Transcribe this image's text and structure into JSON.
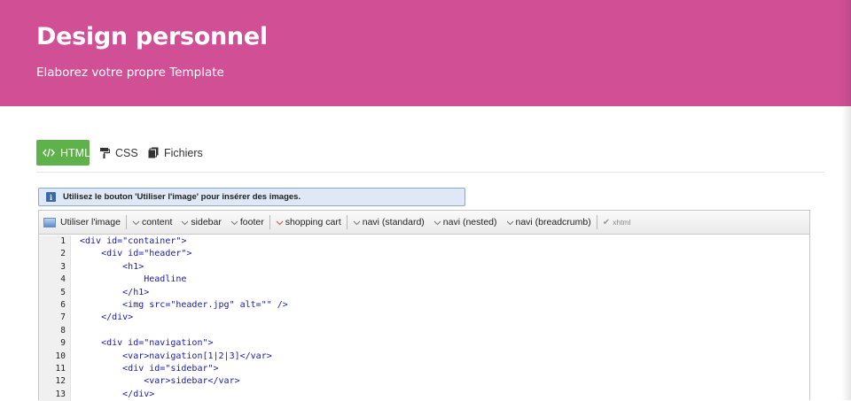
{
  "header": {
    "title": "Design personnel",
    "subtitle": "Elaborez votre propre Template",
    "background": "#d14f95"
  },
  "tabs": [
    {
      "label": "HTML",
      "icon": "code-icon",
      "active": true
    },
    {
      "label": "CSS",
      "icon": "paint-roller-icon",
      "active": false
    },
    {
      "label": "Fichiers",
      "icon": "files-icon",
      "active": false
    }
  ],
  "info": {
    "icon": "info-icon",
    "message": "Utilisez le bouton 'Utiliser l'image' pour insérer des images."
  },
  "toolbar": {
    "use_image": "Utiliser l'image",
    "content": "content",
    "sidebar": "sidebar",
    "footer": "footer",
    "shopping_cart": "shopping cart",
    "navi_standard": "navi (standard)",
    "navi_nested": "navi (nested)",
    "navi_breadcrumb": "navi (breadcrumb)",
    "xhtml": "xhtml"
  },
  "code": {
    "line_numbers": [
      "1",
      "2",
      "3",
      "4",
      "5",
      "6",
      "7",
      "8",
      "9",
      "10",
      "11",
      "12",
      "13"
    ],
    "lines": [
      "<div id=\"container\">",
      "    <div id=\"header\">",
      "        <h1>",
      "            Headline",
      "        </h1>",
      "        <img src=\"header.jpg\" alt=\"\" />",
      "    </div>",
      "",
      "    <div id=\"navigation\">",
      "        <var>navigation[1|2|3]</var>",
      "        <div id=\"sidebar\">",
      "            <var>sidebar</var>",
      "        </div>"
    ]
  },
  "colors": {
    "accent_green": "#5fb24b",
    "code_text": "#1a1aa6",
    "info_bg": "#dfe8f6"
  }
}
